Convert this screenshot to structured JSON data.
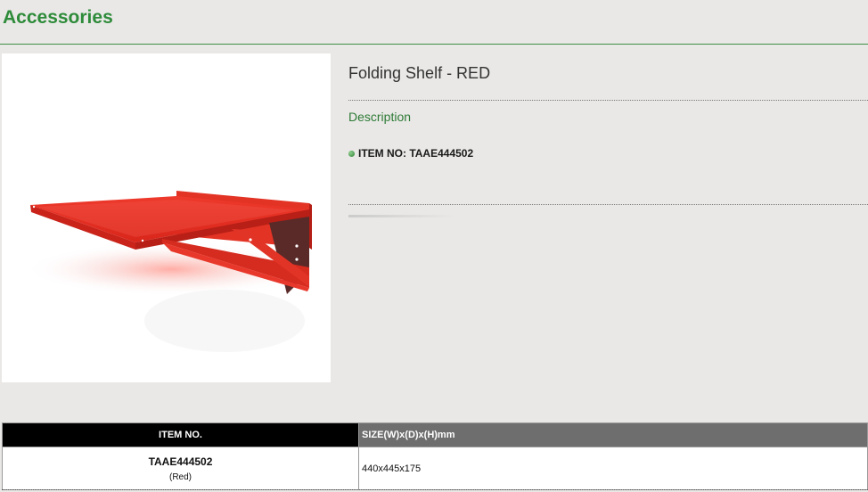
{
  "page": {
    "title": "Accessories"
  },
  "product": {
    "name": "Folding Shelf - RED",
    "description_heading": "Description",
    "item_no_label": "ITEM NO: TAAE444502",
    "image_icon": "folding-shelf-red-image",
    "accent_color": "#e02a1f"
  },
  "table": {
    "headers": [
      "ITEM NO.",
      "SIZE(W)x(D)x(H)mm"
    ],
    "rows": [
      {
        "item_code": "TAAE444502",
        "color": "(Red)",
        "size": "440x445x175"
      }
    ]
  },
  "colors": {
    "title_green": "#2e8b3a",
    "header_black": "#000000",
    "header_gray": "#6e6e6e"
  }
}
